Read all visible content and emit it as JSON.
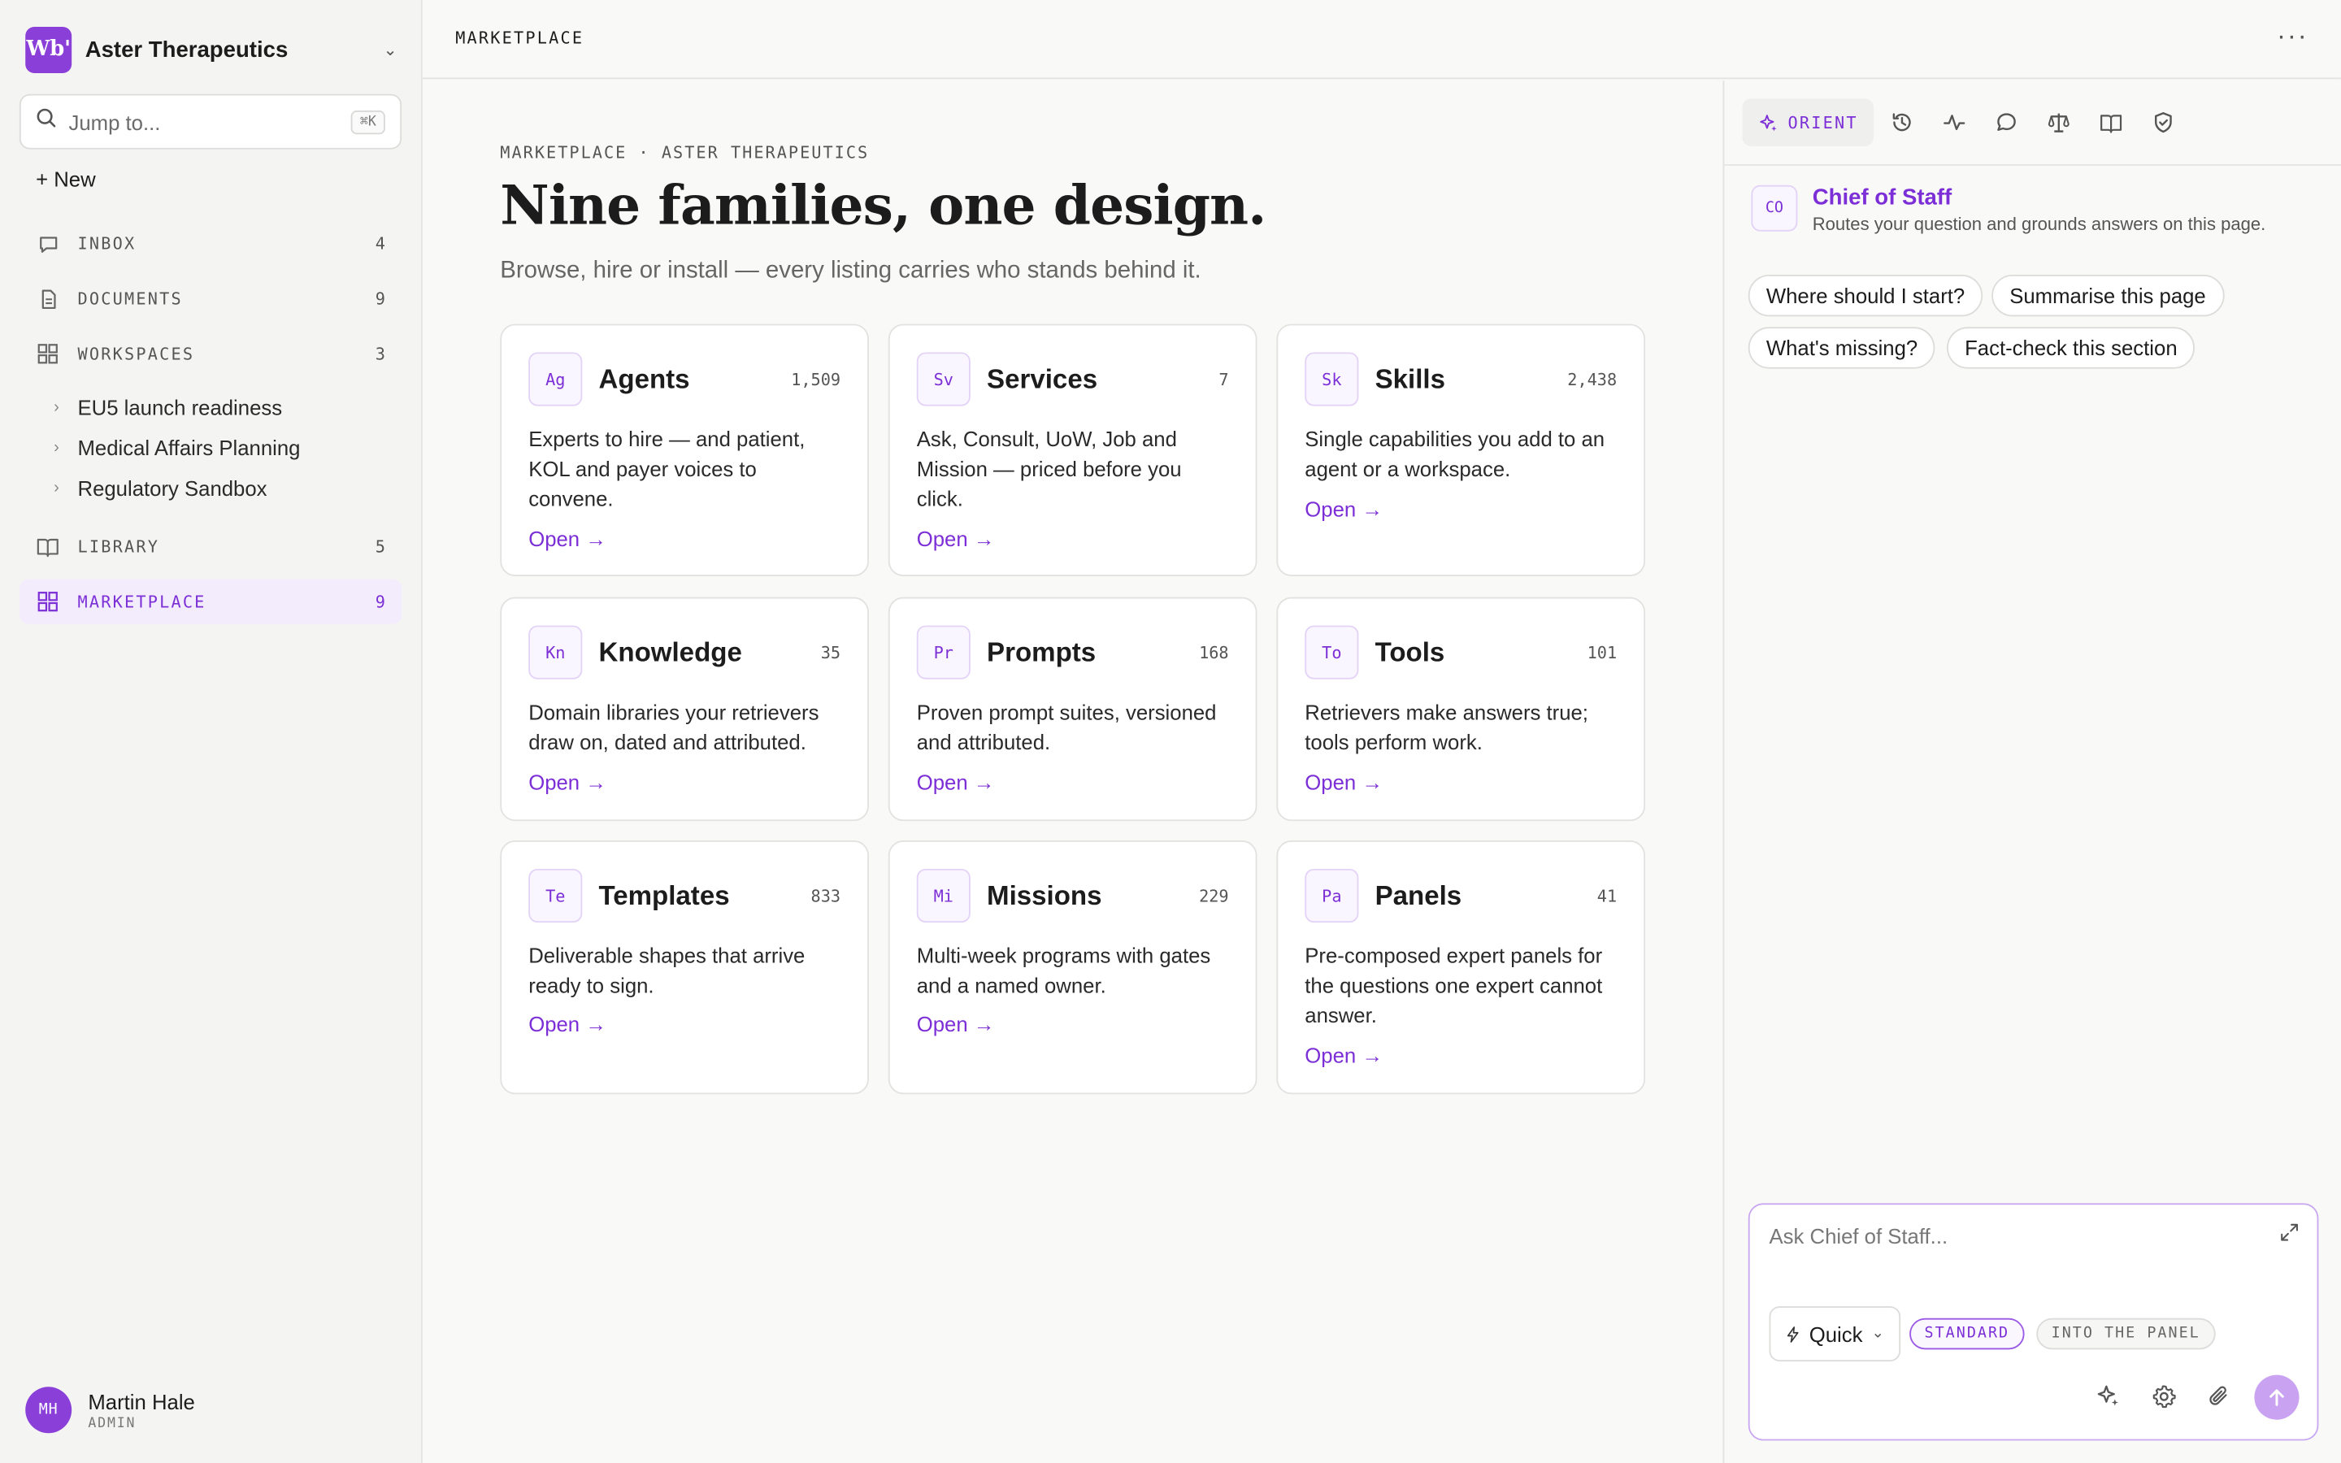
{
  "org": {
    "logo_text": "Wb'",
    "name": "Aster Therapeutics"
  },
  "search": {
    "placeholder": "Jump to...",
    "shortcut": "⌘K"
  },
  "new_label": "+ New",
  "nav": {
    "inbox": {
      "label": "INBOX",
      "count": "4"
    },
    "documents": {
      "label": "DOCUMENTS",
      "count": "9"
    },
    "workspaces": {
      "label": "WORKSPACES",
      "count": "3"
    },
    "library": {
      "label": "LIBRARY",
      "count": "5"
    },
    "marketplace": {
      "label": "MARKETPLACE",
      "count": "9"
    }
  },
  "workspaces": [
    "EU5 launch readiness",
    "Medical Affairs Planning",
    "Regulatory Sandbox"
  ],
  "user": {
    "initials": "MH",
    "name": "Martin Hale",
    "role": "ADMIN"
  },
  "topbar": {
    "breadcrumb": "MARKETPLACE"
  },
  "main": {
    "eyebrow": "MARKETPLACE · ASTER THERAPEUTICS",
    "title": "Nine families, one design.",
    "subtitle": "Browse, hire or install — every listing carries who stands behind it."
  },
  "cards": [
    {
      "badge": "Ag",
      "name": "Agents",
      "count": "1,509",
      "desc": "Experts to hire — and patient, KOL and payer voices to convene.",
      "open": "Open →"
    },
    {
      "badge": "Sv",
      "name": "Services",
      "count": "7",
      "desc": "Ask, Consult, UoW, Job and Mission — priced before you click.",
      "open": "Open →"
    },
    {
      "badge": "Sk",
      "name": "Skills",
      "count": "2,438",
      "desc": "Single capabilities you add to an agent or a workspace.",
      "open": "Open →"
    },
    {
      "badge": "Kn",
      "name": "Knowledge",
      "count": "35",
      "desc": "Domain libraries your retrievers draw on, dated and attributed.",
      "open": "Open →"
    },
    {
      "badge": "Pr",
      "name": "Prompts",
      "count": "168",
      "desc": "Proven prompt suites, versioned and attributed.",
      "open": "Open →"
    },
    {
      "badge": "To",
      "name": "Tools",
      "count": "101",
      "desc": "Retrievers make answers true; tools perform work.",
      "open": "Open →"
    },
    {
      "badge": "Te",
      "name": "Templates",
      "count": "833",
      "desc": "Deliverable shapes that arrive ready to sign.",
      "open": "Open →"
    },
    {
      "badge": "Mi",
      "name": "Missions",
      "count": "229",
      "desc": "Multi-week programs with gates and a named owner.",
      "open": "Open →"
    },
    {
      "badge": "Pa",
      "name": "Panels",
      "count": "41",
      "desc": "Pre-composed expert panels for the questions one expert cannot answer.",
      "open": "Open →"
    }
  ],
  "panel": {
    "tab_active": "ORIENT",
    "agent": {
      "badge": "CO",
      "name": "Chief of Staff",
      "subtitle": "Routes your question and grounds answers on this page."
    },
    "chips": [
      "Where should I start?",
      "Summarise this page",
      "What's missing?",
      "Fact-check this section"
    ],
    "composer": {
      "placeholder": "Ask Chief of Staff...",
      "mode": "Quick",
      "pill_standard": "STANDARD",
      "pill_panel": "INTO THE PANEL"
    }
  },
  "colors": {
    "accent": "#7c2fd6",
    "accent_light": "#f3ecfc",
    "send_button": "#c9a2f2"
  }
}
